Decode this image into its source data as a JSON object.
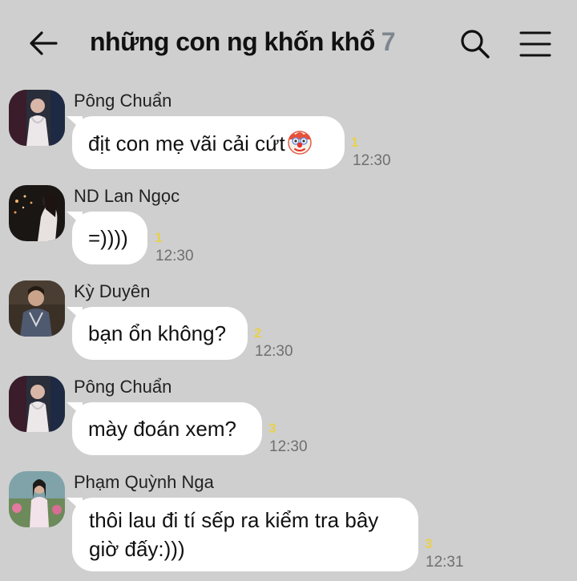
{
  "header": {
    "title": "những con ng khốn khổ",
    "member_count": "7",
    "back_icon": "arrow-left-icon",
    "search_icon": "search-icon",
    "menu_icon": "hamburger-menu-icon"
  },
  "messages": [
    {
      "sender": "Pông Chuẩn",
      "text": "địt con mẹ vãi cải cứt",
      "emoji": "clown-face-icon",
      "unread": "1",
      "time": "12:30"
    },
    {
      "sender": "ND Lan Ngọc",
      "text": "=))))",
      "unread": "1",
      "time": "12:30"
    },
    {
      "sender": "Kỳ Duyên",
      "text": "bạn ổn không?",
      "unread": "2",
      "time": "12:30"
    },
    {
      "sender": "Pông Chuẩn",
      "text": "mày đoán xem?",
      "unread": "3",
      "time": "12:30"
    },
    {
      "sender": "Phạm Quỳnh Nga",
      "text_line1": "thôi lau đi tí sếp ra kiểm tra bây",
      "text_line2": "giờ đấy:)))",
      "unread": "3",
      "time": "12:31"
    }
  ],
  "colors": {
    "background": "#cfcfcf",
    "bubble": "#ffffff",
    "unread": "#e9d04c",
    "count": "#7e868f"
  }
}
